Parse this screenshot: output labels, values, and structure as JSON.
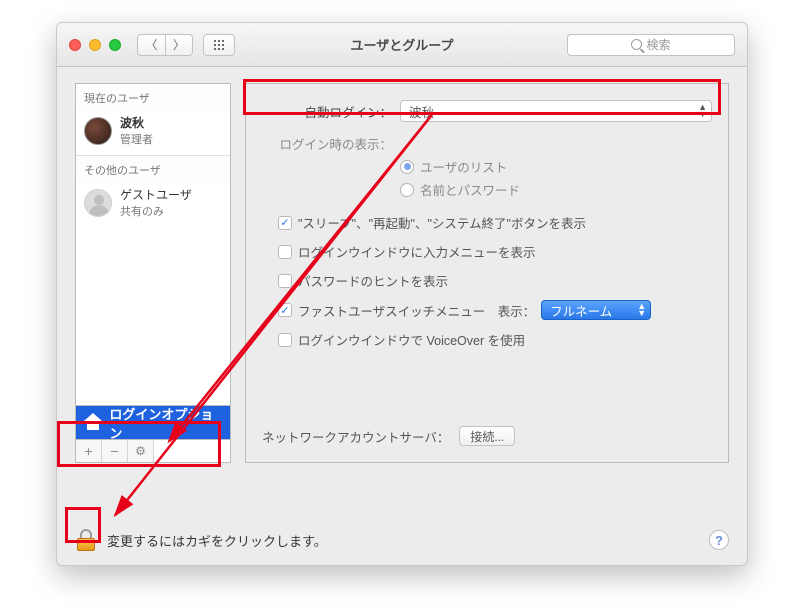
{
  "titlebar": {
    "title": "ユーザとグループ",
    "search_placeholder": "検索"
  },
  "sidebar": {
    "current_heading": "現在のユーザ",
    "current_user": {
      "name": "波秋",
      "role": "管理者"
    },
    "other_heading": "その他のユーザ",
    "guest_user": {
      "name": "ゲストユーザ",
      "role": "共有のみ"
    },
    "login_options": "ログインオプション",
    "plus": "+",
    "minus": "−",
    "gear": "⚙"
  },
  "panel": {
    "auto_login_label": "自動ログイン：",
    "auto_login_value": "波秋",
    "login_display_label": "ログイン時の表示：",
    "radio_list": "ユーザのリスト",
    "radio_namepw": "名前とパスワード",
    "chk_sleep": "\"スリープ\"、\"再起動\"、\"システム終了\"ボタンを表示",
    "chk_input": "ログインウインドウに入力メニューを表示",
    "chk_hint": "パスワードのヒントを表示",
    "chk_fastswitch": "ファストユーザスイッチメニュー　表示：",
    "fastswitch_value": "フルネーム",
    "chk_voiceover": "ログインウインドウで VoiceOver を使用",
    "network_label": "ネットワークアカウントサーバ：",
    "network_button": "接続..."
  },
  "bottom": {
    "lock_text": "変更するにはカギをクリックします。",
    "help": "?"
  }
}
